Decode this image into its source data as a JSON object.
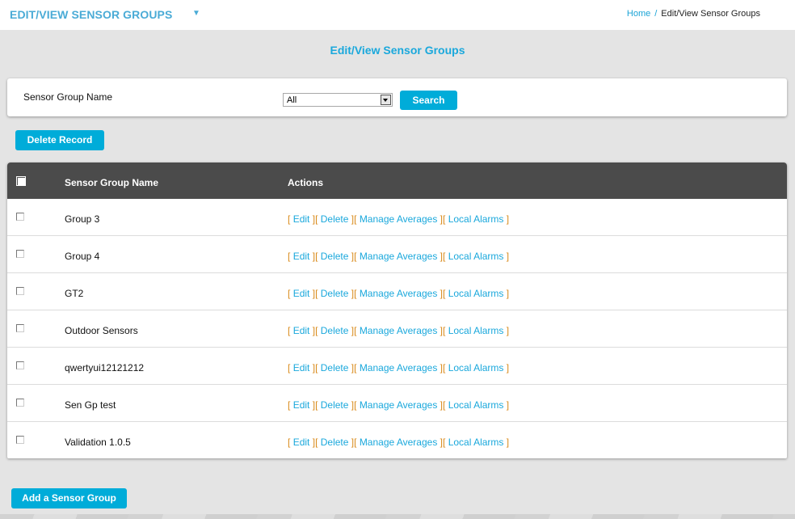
{
  "header": {
    "app_title": "EDIT/VIEW SENSOR GROUPS",
    "caret_icon": "triangle-down",
    "breadcrumb": {
      "home": "Home",
      "separator": "/",
      "current": "Edit/View Sensor Groups"
    }
  },
  "page": {
    "title": "Edit/View Sensor Groups"
  },
  "search": {
    "label": "Sensor Group Name",
    "select_value": "All",
    "button": "Search"
  },
  "buttons": {
    "delete_record": "Delete Record",
    "add_group": "Add a Sensor Group"
  },
  "table": {
    "columns": [
      "Sensor Group Name",
      "Actions"
    ],
    "action_labels": {
      "open": "[",
      "close": "]",
      "edit": "Edit",
      "delete": "Delete",
      "manage_averages": "Manage Averages",
      "local_alarms": "Local Alarms"
    },
    "rows": [
      {
        "name": "Group 3",
        "checked": false
      },
      {
        "name": "Group 4",
        "checked": false
      },
      {
        "name": "GT2",
        "checked": false
      },
      {
        "name": "Outdoor Sensors",
        "checked": false
      },
      {
        "name": "qwertyui12121212",
        "checked": false
      },
      {
        "name": "Sen Gp test",
        "checked": false
      },
      {
        "name": "Validation 1.0.5",
        "checked": false
      }
    ]
  },
  "colors": {
    "accent": "#00acd9",
    "header_bg": "#4b4b4b",
    "bracket": "#d98a1a",
    "page_bg": "#e4e4e4"
  }
}
